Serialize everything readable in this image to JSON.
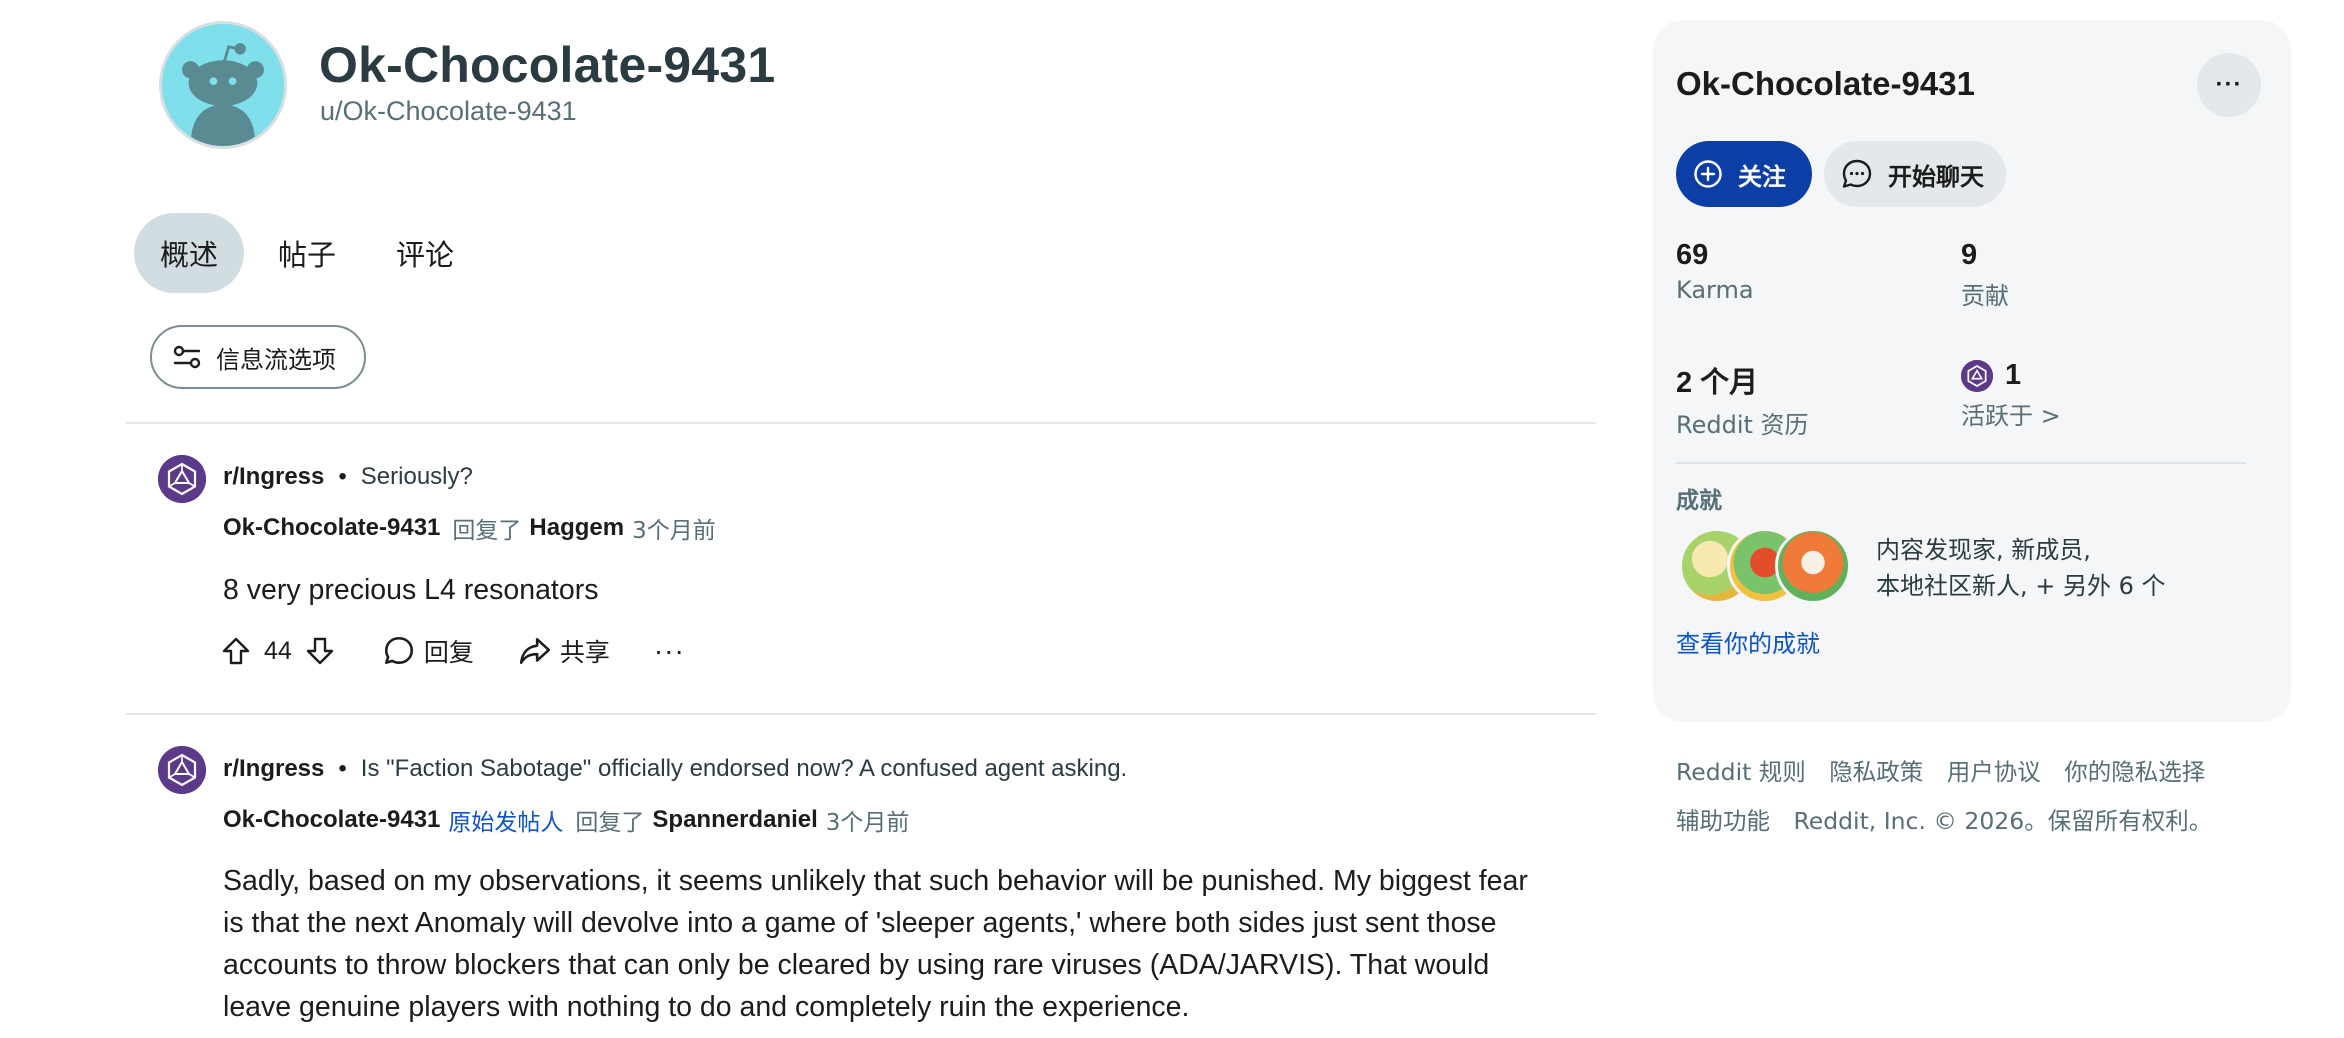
{
  "profile": {
    "display_name": "Ok-Chocolate-9431",
    "username": "u/Ok-Chocolate-9431"
  },
  "tabs": [
    {
      "label": "概述",
      "active": true
    },
    {
      "label": "帖子",
      "active": false
    },
    {
      "label": "评论",
      "active": false
    }
  ],
  "feed_options_label": "信息流选项",
  "comments": [
    {
      "subreddit": "r/Ingress",
      "post_title": "Seriously?",
      "author": "Ok-Chocolate-9431",
      "op_badge": "",
      "replied_label": "回复了",
      "replied_to": "Haggem",
      "time": "3个月前",
      "body": "8 very precious L4 resonators",
      "votes": "44",
      "reply_label": "回复",
      "share_label": "共享",
      "more_label": "···"
    },
    {
      "subreddit": "r/Ingress",
      "post_title": "Is \"Faction Sabotage\" officially endorsed now? A confused agent asking.",
      "author": "Ok-Chocolate-9431",
      "op_badge": "原始发帖人",
      "replied_label": "回复了",
      "replied_to": "Spannerdaniel",
      "time": "3个月前",
      "body_lines": [
        "Sadly, based on my observations, it seems unlikely that such behavior will be punished. My biggest fear",
        "is that the next Anomaly will devolve into a game of 'sleeper agents,' where both sides just sent those",
        "accounts to throw blockers that can only be cleared by using rare viruses (ADA/JARVIS). That would",
        "leave genuine players with nothing to do and completely ruin the experience."
      ]
    }
  ],
  "sidebar": {
    "name": "Ok-Chocolate-9431",
    "more_label": "···",
    "follow_label": "关注",
    "chat_label": "开始聊天",
    "stats": [
      {
        "value": "69",
        "label": "Karma"
      },
      {
        "value": "9",
        "label": "贡献"
      },
      {
        "value": "2 个月",
        "label": "Reddit 资历"
      },
      {
        "value": "1",
        "label": "活跃于 >"
      }
    ],
    "achievements_heading": "成就",
    "achievements_line1": "内容发现家, 新成员,",
    "achievements_line2": "本地社区新人, + 另外 6 个",
    "achievements_link": "查看你的成就"
  },
  "footer": {
    "links_row1": [
      "Reddit 规则",
      "隐私政策",
      "用户协议",
      "你的隐私选择"
    ],
    "links_row2": [
      "辅助功能",
      "Reddit, Inc. © 2026。保留所有权利。"
    ]
  },
  "colors": {
    "accent_blue": "#0d3ea6",
    "link_blue": "#0e54c2",
    "avatar_bg": "#7fe0ec",
    "subreddit_icon": "#5b3a8a",
    "active_tab_bg": "#d2dde2",
    "sidebar_bg": "#f4f6f7"
  },
  "icons": {
    "avatar": "snoo-avatar-icon",
    "subreddit": "ingress-logo-icon",
    "upvote": "arrow-up-icon",
    "downvote": "arrow-down-icon",
    "reply": "speech-bubble-icon",
    "share": "share-arrow-icon",
    "feed_options": "sliders-icon",
    "follow": "plus-circle-icon",
    "chat": "chat-bubble-icon"
  }
}
